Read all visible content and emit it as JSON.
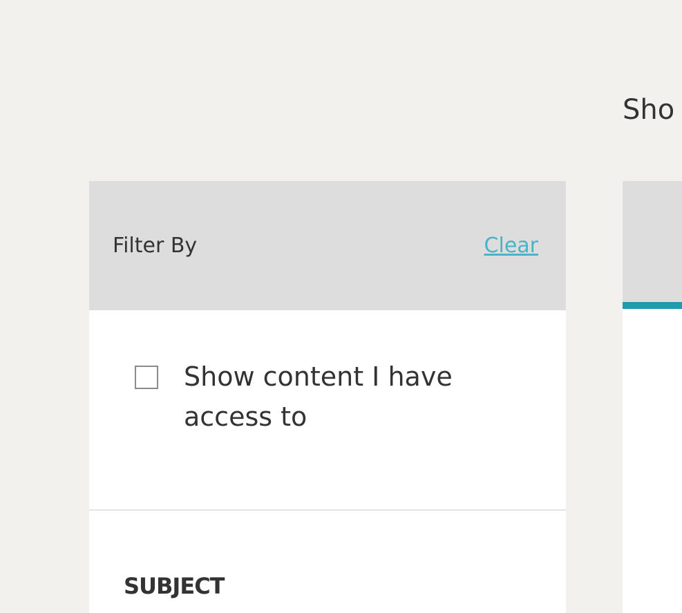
{
  "results": {
    "heading": "Sho"
  },
  "filter": {
    "title": "Filter By",
    "clear_label": "Clear",
    "access_checkbox": {
      "label": "Show content I have access to",
      "checked": false
    },
    "subject_heading": "SUBJECT"
  },
  "colors": {
    "page_background": "#f3f1ee",
    "panel_header": "#dddddd",
    "link": "#4ab3c9",
    "tab_accent": "#1f9bac"
  }
}
